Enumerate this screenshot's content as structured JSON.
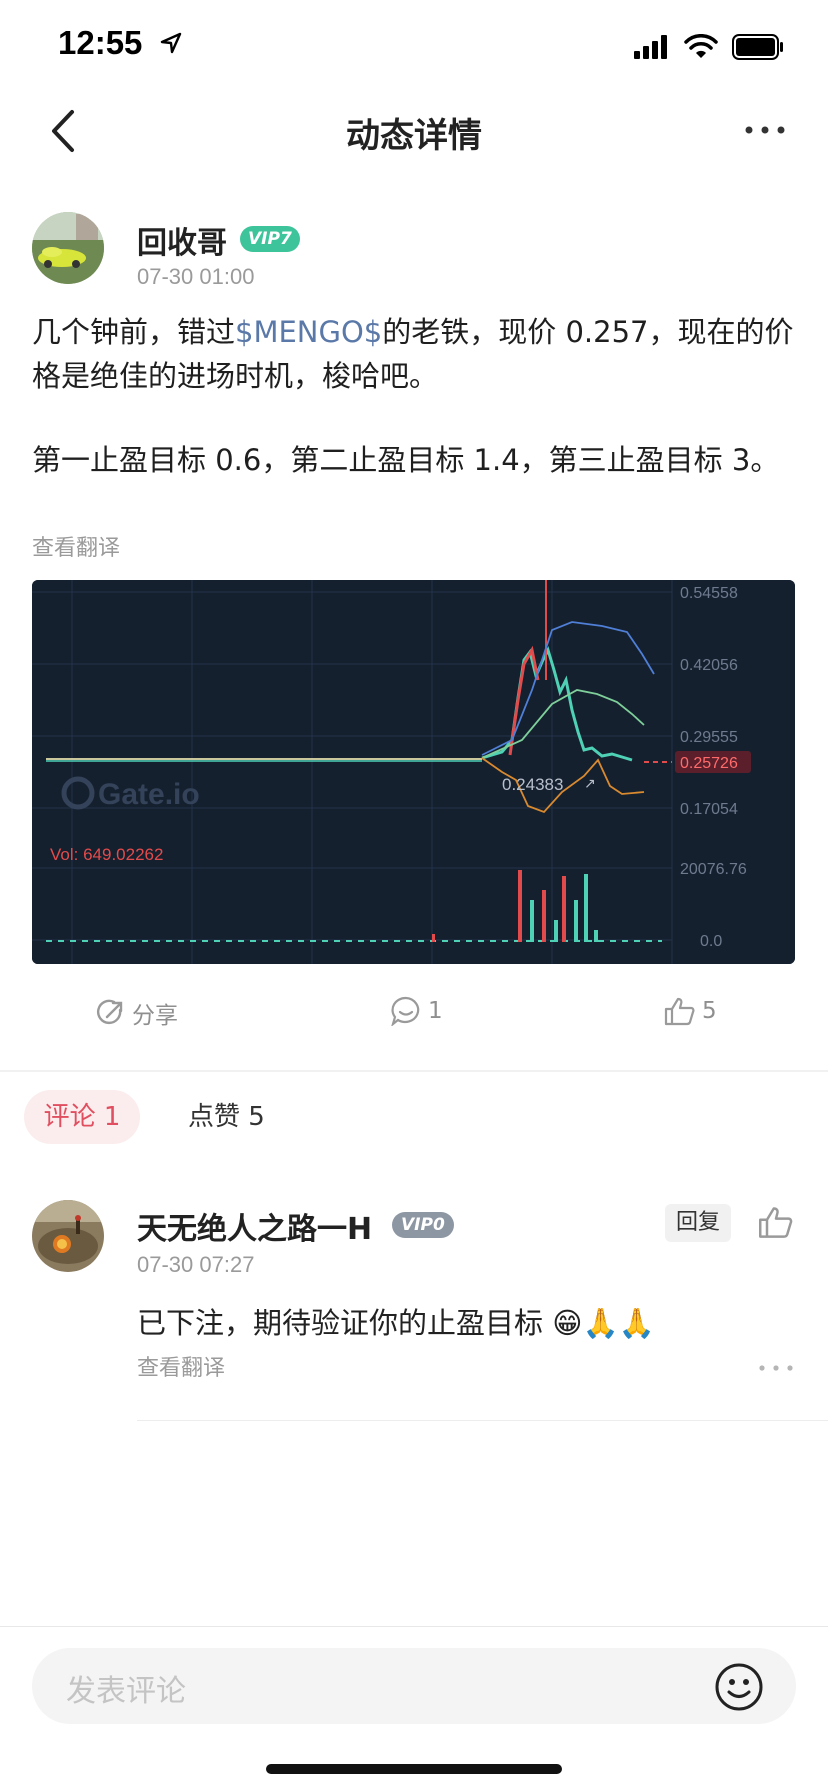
{
  "status_bar": {
    "time": "12:55"
  },
  "nav": {
    "title": "动态详情"
  },
  "post": {
    "author": "回收哥",
    "vip": "VIP7",
    "time": "07-30 01:00",
    "text_line1_before": "几个钟前，错过",
    "ticker": "$MENGO$",
    "text_line1_after": "的老铁，现价 0.257，现在的价格是绝佳的进场时机，梭哈吧。",
    "text_line2": "第一止盈目标 0.6，第二止盈目标 1.4，第三止盈目标 3。",
    "translate": "查看翻译",
    "chart_labels": {
      "prices": [
        "0.54558",
        "0.42056",
        "0.29555",
        "0.17054"
      ],
      "current_price": "0.25726",
      "marker": "0.24383",
      "watermark": "Gate.io",
      "vol_text": "Vol: 649.02262",
      "vol_ticks": [
        "20076.76",
        "0.0"
      ]
    }
  },
  "actions": {
    "share": "分享",
    "comments": "1",
    "likes": "5"
  },
  "tabs": {
    "comments": "评论 1",
    "likes": "点赞 5"
  },
  "comment": {
    "user": "天无绝人之路一H",
    "vip": "VIP0",
    "time": "07-30 07:27",
    "text": "已下注，期待验证你的止盈目标",
    "emojis": "😁🙏🙏",
    "reply": "回复",
    "translate": "查看翻译"
  },
  "input": {
    "placeholder": "发表评论"
  },
  "colors": {
    "accent_red": "#e04f5f",
    "vip_green": "#3ec49a",
    "link": "#5b79a8"
  }
}
